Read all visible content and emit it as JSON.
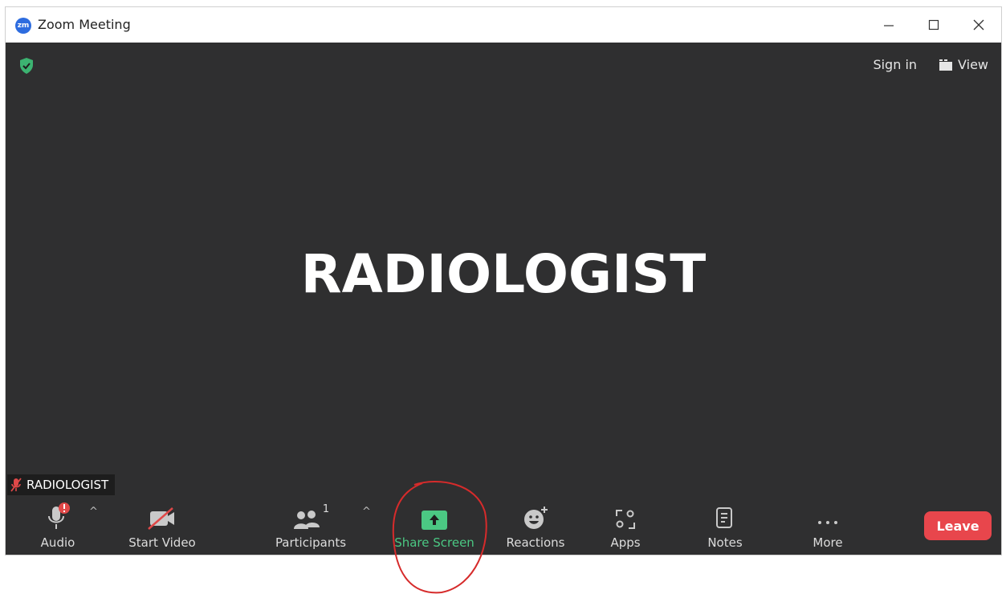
{
  "window": {
    "logo_text": "zm",
    "title": "Zoom Meeting",
    "controls": [
      "minimize-icon",
      "maximize-icon",
      "close-icon"
    ]
  },
  "meeting": {
    "security_icon": "shield-check-icon",
    "sign_in": "Sign in",
    "view": "View",
    "speaker_display_name": "RADIOLOGIST",
    "name_tag": "RADIOLOGIST"
  },
  "toolbar": {
    "audio": "Audio",
    "start_video": "Start Video",
    "participants": "Participants",
    "participants_count": "1",
    "share_screen": "Share Screen",
    "reactions": "Reactions",
    "apps": "Apps",
    "notes": "Notes",
    "more": "More",
    "leave": "Leave"
  },
  "colors": {
    "meeting_bg": "#2f2f30",
    "share_green": "#4bc883",
    "leave_red": "#e8464c",
    "annotation_red": "#d62b2b"
  }
}
